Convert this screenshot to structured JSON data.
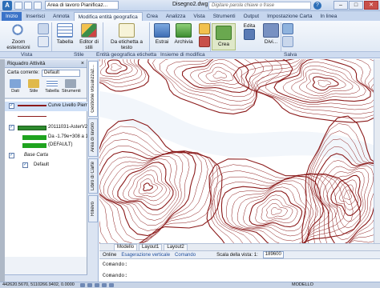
{
  "app": {
    "workspace": "Area di lavoro Pianificaz...",
    "doc_title": "Disegno2.dwg",
    "search_placeholder": "Digitare parola chiave o frase",
    "help": "?",
    "win_min": "–",
    "win_max": "□",
    "win_close": "✕"
  },
  "tabs": [
    "Inizio",
    "Inserisci",
    "Annota",
    "Modifica entità geografica",
    "Crea",
    "Analizza",
    "Vista",
    "Strumenti",
    "Output",
    "Impostazione Carta",
    "In linea"
  ],
  "ribbon": {
    "zoom_label": "Zoom estensioni",
    "tabella_label": "Tabella",
    "editor_label": "Editor di stili",
    "etichetta_label": "Da etichetta a testo",
    "estrai_label": "Estrai",
    "archivia_label": "Archivia",
    "crea_label": "Crea",
    "edita_label": "Edita",
    "divi_label": "Divi..."
  },
  "ribbon_groups": [
    "Vista",
    "Stile",
    "Entità geografica etichetta",
    "Insieme di modifica",
    "Salva"
  ],
  "palette": {
    "title": "Riquadro Attività",
    "close": "×",
    "map_label": "Carta corrente:",
    "map_value": "Default",
    "tools": [
      "Dati",
      "Stile",
      "Tabella",
      "Strumenti"
    ]
  },
  "layers": {
    "curve": "Curve Livello Piemo",
    "aster": "20111031-AsterV2-",
    "range": "Da -1.79e+308 a 1",
    "default_range": "(DEFAULT)",
    "base": "Base Carta",
    "default": "Default"
  },
  "vertical_tabs": [
    "Gestione visualizzaz...",
    "Area di lavoro",
    "Libro di Carte",
    "Rilievo"
  ],
  "layout_tabs": [
    "Modello",
    "Layout1",
    "Layout2"
  ],
  "status": {
    "online": "Online",
    "exaggeration": "Esagerazione verticale",
    "comando": "Comando",
    "scale_label": "Scala della vista: 1:",
    "scale_value": "189600"
  },
  "command": {
    "line1": "Comando:",
    "line2": "Comando:"
  },
  "statusbar": {
    "coords": "442620.5670, 5110266.9402, 0.0000",
    "model": "MODELLO"
  },
  "colors": {
    "contour": "#8b1a1a",
    "accent": "#2d6fb8"
  }
}
